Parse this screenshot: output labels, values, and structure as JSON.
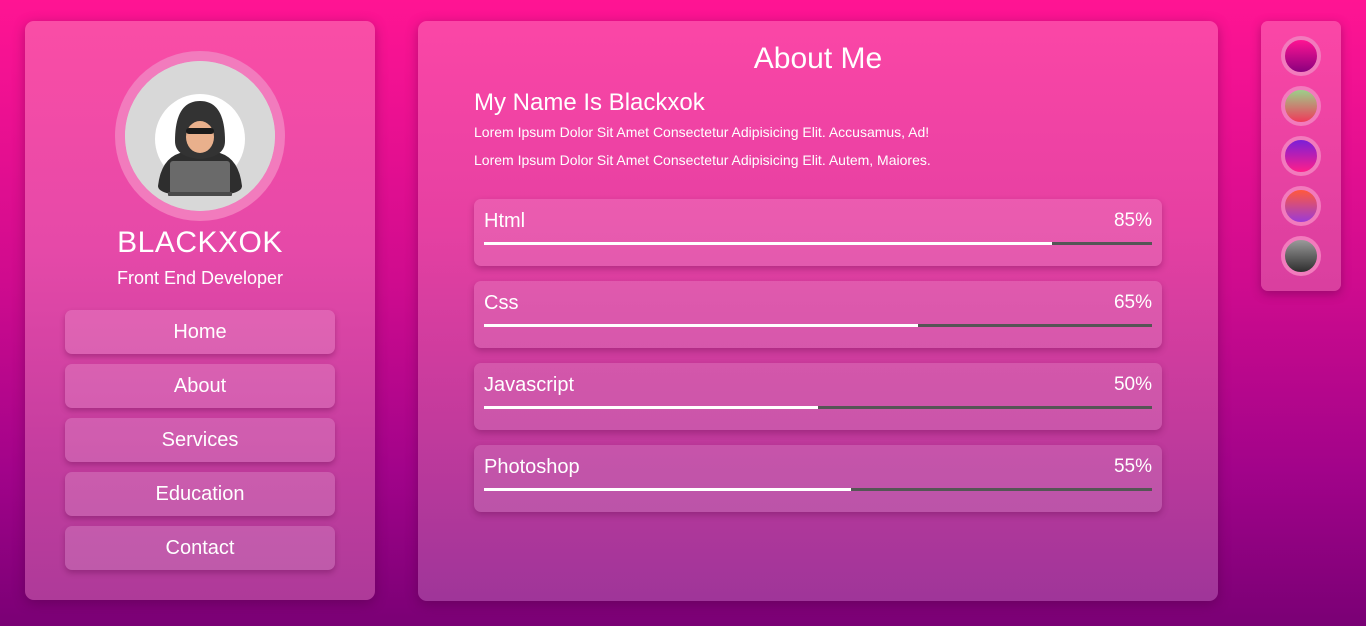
{
  "profile": {
    "name": "BLACKXOK",
    "role": "Front End Developer",
    "avatar_icon": "hacker-avatar-icon"
  },
  "nav": {
    "items": [
      {
        "label": "Home"
      },
      {
        "label": "About"
      },
      {
        "label": "Services"
      },
      {
        "label": "Education"
      },
      {
        "label": "Contact"
      }
    ]
  },
  "about": {
    "title": "About Me",
    "subtitle": "My Name Is Blackxok",
    "paragraphs": [
      "Lorem Ipsum Dolor Sit Amet Consectetur Adipisicing Elit. Accusamus, Ad!",
      "Lorem Ipsum Dolor Sit Amet Consectetur Adipisicing Elit. Autem, Maiores."
    ]
  },
  "skills": [
    {
      "name": "Html",
      "percent_label": "85%",
      "level": 85
    },
    {
      "name": "Css",
      "percent_label": "65%",
      "level": 65
    },
    {
      "name": "Javascript",
      "percent_label": "50%",
      "level": 50
    },
    {
      "name": "Photoshop",
      "percent_label": "55%",
      "level": 55
    }
  ],
  "theme_palette": {
    "swatches": [
      {
        "colors": [
          "#ff1493",
          "#8a007e"
        ]
      },
      {
        "colors": [
          "#9cd08a",
          "#f03a5a"
        ]
      },
      {
        "colors": [
          "#7a1fd8",
          "#ff1e8a"
        ]
      },
      {
        "colors": [
          "#ff5a3c",
          "#9b3bd6"
        ]
      },
      {
        "colors": [
          "#9a9a9a",
          "#2e2e2e"
        ]
      }
    ]
  },
  "colors": {
    "background_top": "#ff1493",
    "background_bottom": "#7a0075",
    "progress_fill": "#ffffff",
    "progress_track": "#555555"
  }
}
